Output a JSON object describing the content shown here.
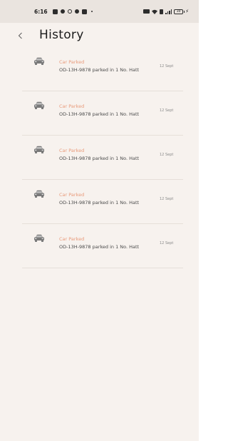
{
  "status_bar": {
    "time": "6:16",
    "battery": "30"
  },
  "header": {
    "title": "History",
    "back_icon": "chevron-left-icon"
  },
  "history": [
    {
      "icon": "car-icon",
      "title": "Car Parked",
      "description": "OD-13H-9878 parked in 1 No. Hatt",
      "date": "12 Sept"
    },
    {
      "icon": "car-icon",
      "title": "Car Parked",
      "description": "OD-13H-9878 parked in 1 No. Hatt",
      "date": "12 Sept"
    },
    {
      "icon": "car-icon",
      "title": "Car Parked",
      "description": "OD-13H-9878 parked in 1 No. Hatt",
      "date": "12 Sept"
    },
    {
      "icon": "car-icon",
      "title": "Car Parked",
      "description": "OD-13H-9878 parked in 1 No. Hatt",
      "date": "12 Sept"
    },
    {
      "icon": "car-icon",
      "title": "Car Parked",
      "description": "OD-13H-9878 parked in 1 No. Hatt",
      "date": "12 Sept"
    }
  ],
  "colors": {
    "background": "#f7f2ee",
    "accent": "#e89a7a",
    "divider": "#e6dfd9"
  }
}
